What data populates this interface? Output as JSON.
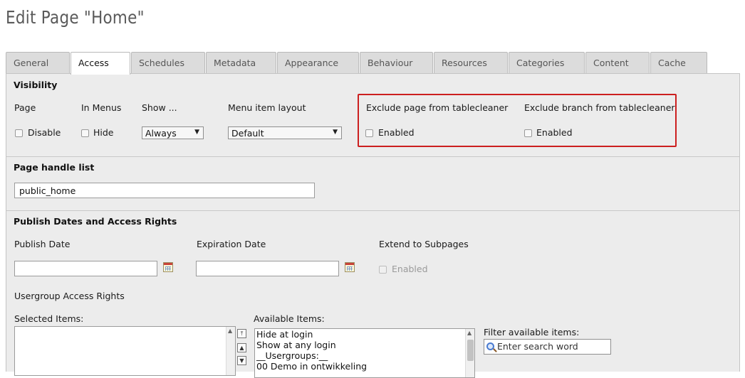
{
  "page": {
    "title": "Edit Page \"Home\""
  },
  "tabs": [
    {
      "label": "General"
    },
    {
      "label": "Access"
    },
    {
      "label": "Schedules"
    },
    {
      "label": "Metadata"
    },
    {
      "label": "Appearance"
    },
    {
      "label": "Behaviour"
    },
    {
      "label": "Resources"
    },
    {
      "label": "Categories"
    },
    {
      "label": "Content"
    },
    {
      "label": "Cache"
    }
  ],
  "active_tab": "Access",
  "visibility": {
    "title": "Visibility",
    "page_label": "Page",
    "page_checkbox": "Disable",
    "menus_label": "In Menus",
    "menus_checkbox": "Hide",
    "show_label": "Show ...",
    "show_value": "Always",
    "layout_label": "Menu item layout",
    "layout_value": "Default",
    "exclude_page_label": "Exclude page from tablecleaner",
    "exclude_page_checkbox": "Enabled",
    "exclude_branch_label": "Exclude branch from tablecleaner",
    "exclude_branch_checkbox": "Enabled"
  },
  "handle": {
    "title": "Page handle list",
    "value": "public_home"
  },
  "publish": {
    "title": "Publish Dates and Access Rights",
    "publish_label": "Publish Date",
    "expiration_label": "Expiration Date",
    "extend_label": "Extend to Subpages",
    "extend_checkbox": "Enabled",
    "usergroup_label": "Usergroup Access Rights",
    "selected_label": "Selected Items:",
    "available_label": "Available Items:",
    "available_items": [
      "Hide at login",
      "Show at any login",
      "__Usergroups:__",
      "00 Demo in ontwikkeling"
    ],
    "filter_label": "Filter available items:",
    "filter_placeholder": "Enter search word"
  },
  "colors": {
    "highlight": "#cc1f1f",
    "tab_bg": "#dcdcdc",
    "panel_bg": "#ececec"
  }
}
